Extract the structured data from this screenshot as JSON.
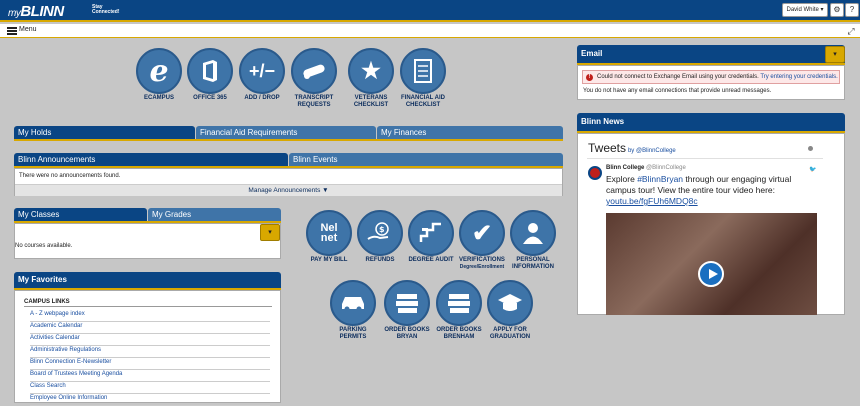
{
  "header": {
    "logo_my": "my",
    "logo_blinn": "BLINN",
    "tagline_1": "Stay",
    "tagline_2": "Connected!",
    "user_label": "David White ▾",
    "gear_glyph": "⚙",
    "help_glyph": "?"
  },
  "menubar": {
    "label": "Menu"
  },
  "top_icons": [
    {
      "label": "eCAMPUS",
      "glyph": "e",
      "icon": "ecampus-icon"
    },
    {
      "label": "OFFICE 365",
      "glyph": "",
      "icon": "office365-icon"
    },
    {
      "label": "ADD / DROP",
      "glyph": "+/−",
      "icon": "add-drop-icon"
    },
    {
      "label": "TRANSCRIPT REQUESTS",
      "glyph": "",
      "icon": "diploma-icon"
    },
    {
      "label": "VETERANS CHECKLIST",
      "glyph": "★",
      "icon": "star-icon"
    },
    {
      "label": "FINANCIAL AID CHECKLIST",
      "glyph": "",
      "icon": "checklist-icon"
    }
  ],
  "tabs_holds": [
    "My Holds",
    "Financial Aid Requirements",
    "My Finances"
  ],
  "tabs_ann": [
    "Blinn Announcements",
    "Blinn Events"
  ],
  "announcements": {
    "empty_text": "There were no announcements found.",
    "manage_label": "Manage Announcements ▼"
  },
  "tabs_classes": [
    "My Classes",
    "My Grades"
  ],
  "classes": {
    "empty_text": "No courses available."
  },
  "favorites": {
    "title": "My Favorites",
    "section_title": "CAMPUS LINKS",
    "links": [
      "A - Z webpage index",
      "Academic Calendar",
      "Activities Calendar",
      "Administrative Regulations",
      "Blinn Connection E-Newsletter",
      "Board of Trustees Meeting Agenda",
      "Class Search",
      "Employee Online Information"
    ]
  },
  "mid_icons_row1": [
    {
      "label": "PAY MY BILL",
      "sub": "",
      "glyph": "Nel net",
      "icon": "nelnet-icon"
    },
    {
      "label": "REFUNDS",
      "sub": "",
      "glyph": "$",
      "icon": "refund-icon"
    },
    {
      "label": "DEGREE AUDIT",
      "sub": "",
      "glyph": "",
      "icon": "degree-audit-icon"
    },
    {
      "label": "VERIFICATIONS",
      "sub": "Degree/Enrollment",
      "glyph": "✔",
      "icon": "verification-icon"
    },
    {
      "label": "PERSONAL INFORMATION",
      "sub": "",
      "glyph": "",
      "icon": "person-icon"
    }
  ],
  "mid_icons_row2": [
    {
      "label": "PARKING PERMITS",
      "glyph": "",
      "icon": "car-icon"
    },
    {
      "label": "ORDER BOOKS BRYAN",
      "glyph": "",
      "icon": "books-icon"
    },
    {
      "label": "ORDER BOOKS BRENHAM",
      "glyph": "",
      "icon": "books-icon"
    },
    {
      "label": "APPLY FOR GRADUATION",
      "glyph": "",
      "icon": "graduation-cap-icon"
    }
  ],
  "email": {
    "title": "Email",
    "error_text": "Could not connect to Exchange Email using your credentials.",
    "error_link": "Try entering your credentials.",
    "info_text": "You do not have any email connections that provide unread messages."
  },
  "news": {
    "title": "Blinn News",
    "tweets_label": "Tweets",
    "tweets_by": "by @BlinnCollege",
    "tweet_name": "Blinn College",
    "tweet_handle": "@BlinnCollege",
    "tweet_text_1": "Explore ",
    "tweet_hashtag": "#BlinnBryan",
    "tweet_text_2": " through our engaging virtual campus tour! View the entire tour video here:",
    "tweet_link": "youtu.be/fgFUh6MDQ8c"
  },
  "colors": {
    "navy": "#0a4584",
    "tab_blue": "#3f74a8",
    "gold": "#d8a800",
    "icon_blue": "#3e74a8"
  }
}
